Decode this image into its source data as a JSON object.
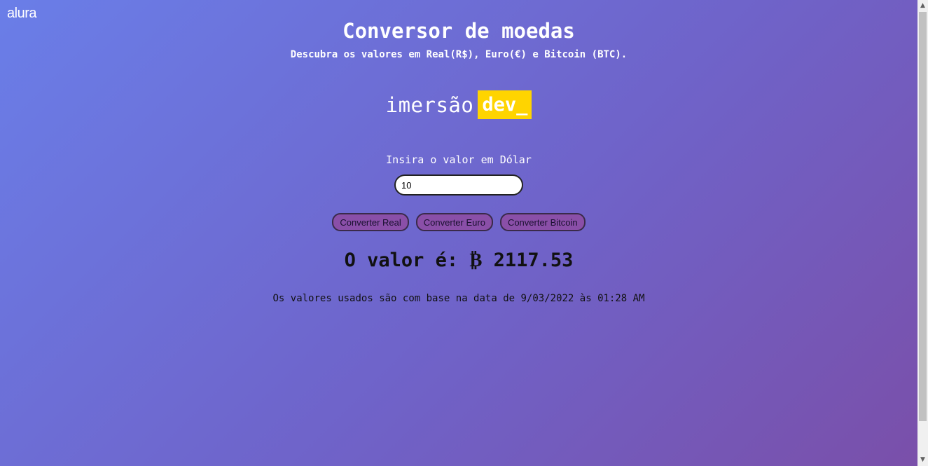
{
  "logo": "alura",
  "header": {
    "title": "Conversor de moedas",
    "subtitle": "Descubra os valores em Real(R$), Euro(€) e Bitcoin (BTC)."
  },
  "brand": {
    "word": "imersão",
    "tag": "dev_"
  },
  "form": {
    "label": "Insira o valor em Dólar",
    "value": "10"
  },
  "buttons": {
    "real": "Converter Real",
    "euro": "Converter Euro",
    "bitcoin": "Converter Bitcoin"
  },
  "result": "O valor é: ₿ 2117.53",
  "footnote": "Os valores usados são com base na data de 9/03/2022 às 01:28 AM",
  "colors": {
    "brand_tag_bg": "#ffd400",
    "button_bg": "#8a4fa8"
  },
  "icons": {
    "scroll_up": "▲",
    "scroll_down": "▼"
  }
}
